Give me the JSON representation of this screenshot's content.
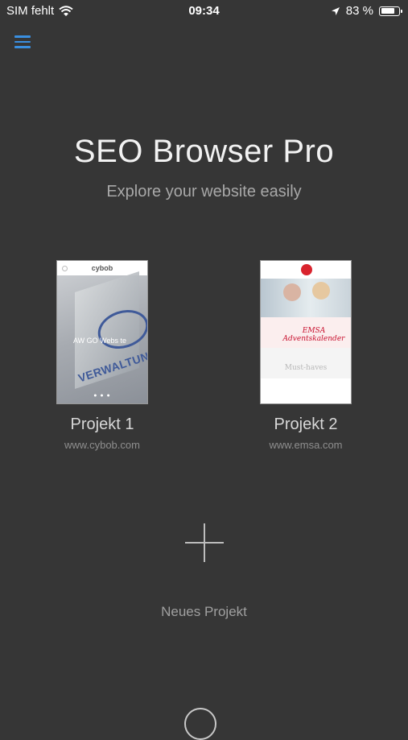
{
  "status_bar": {
    "carrier": "SIM fehlt",
    "time": "09:34",
    "battery_percent": "83 %",
    "battery_level": 0.83
  },
  "header": {
    "title": "SEO Browser Pro",
    "subtitle": "Explore your website easily"
  },
  "projects": [
    {
      "name": "Projekt 1",
      "url": "www.cybob.com",
      "thumb": {
        "site_name": "cybob",
        "headline": "AW GO Webs te",
        "banner": "VERWALTUNG"
      }
    },
    {
      "name": "Projekt 2",
      "url": "www.emsa.com",
      "thumb": {
        "script_text": "EMSA Adventskalender",
        "more_text": "Must-haves"
      }
    }
  ],
  "new_project": {
    "label": "Neues Projekt"
  },
  "colors": {
    "background": "#363636",
    "accent": "#3a8fe0"
  },
  "icons": [
    "wifi-icon",
    "location-arrow-icon",
    "battery-icon",
    "hamburger-menu-icon",
    "plus-icon"
  ]
}
